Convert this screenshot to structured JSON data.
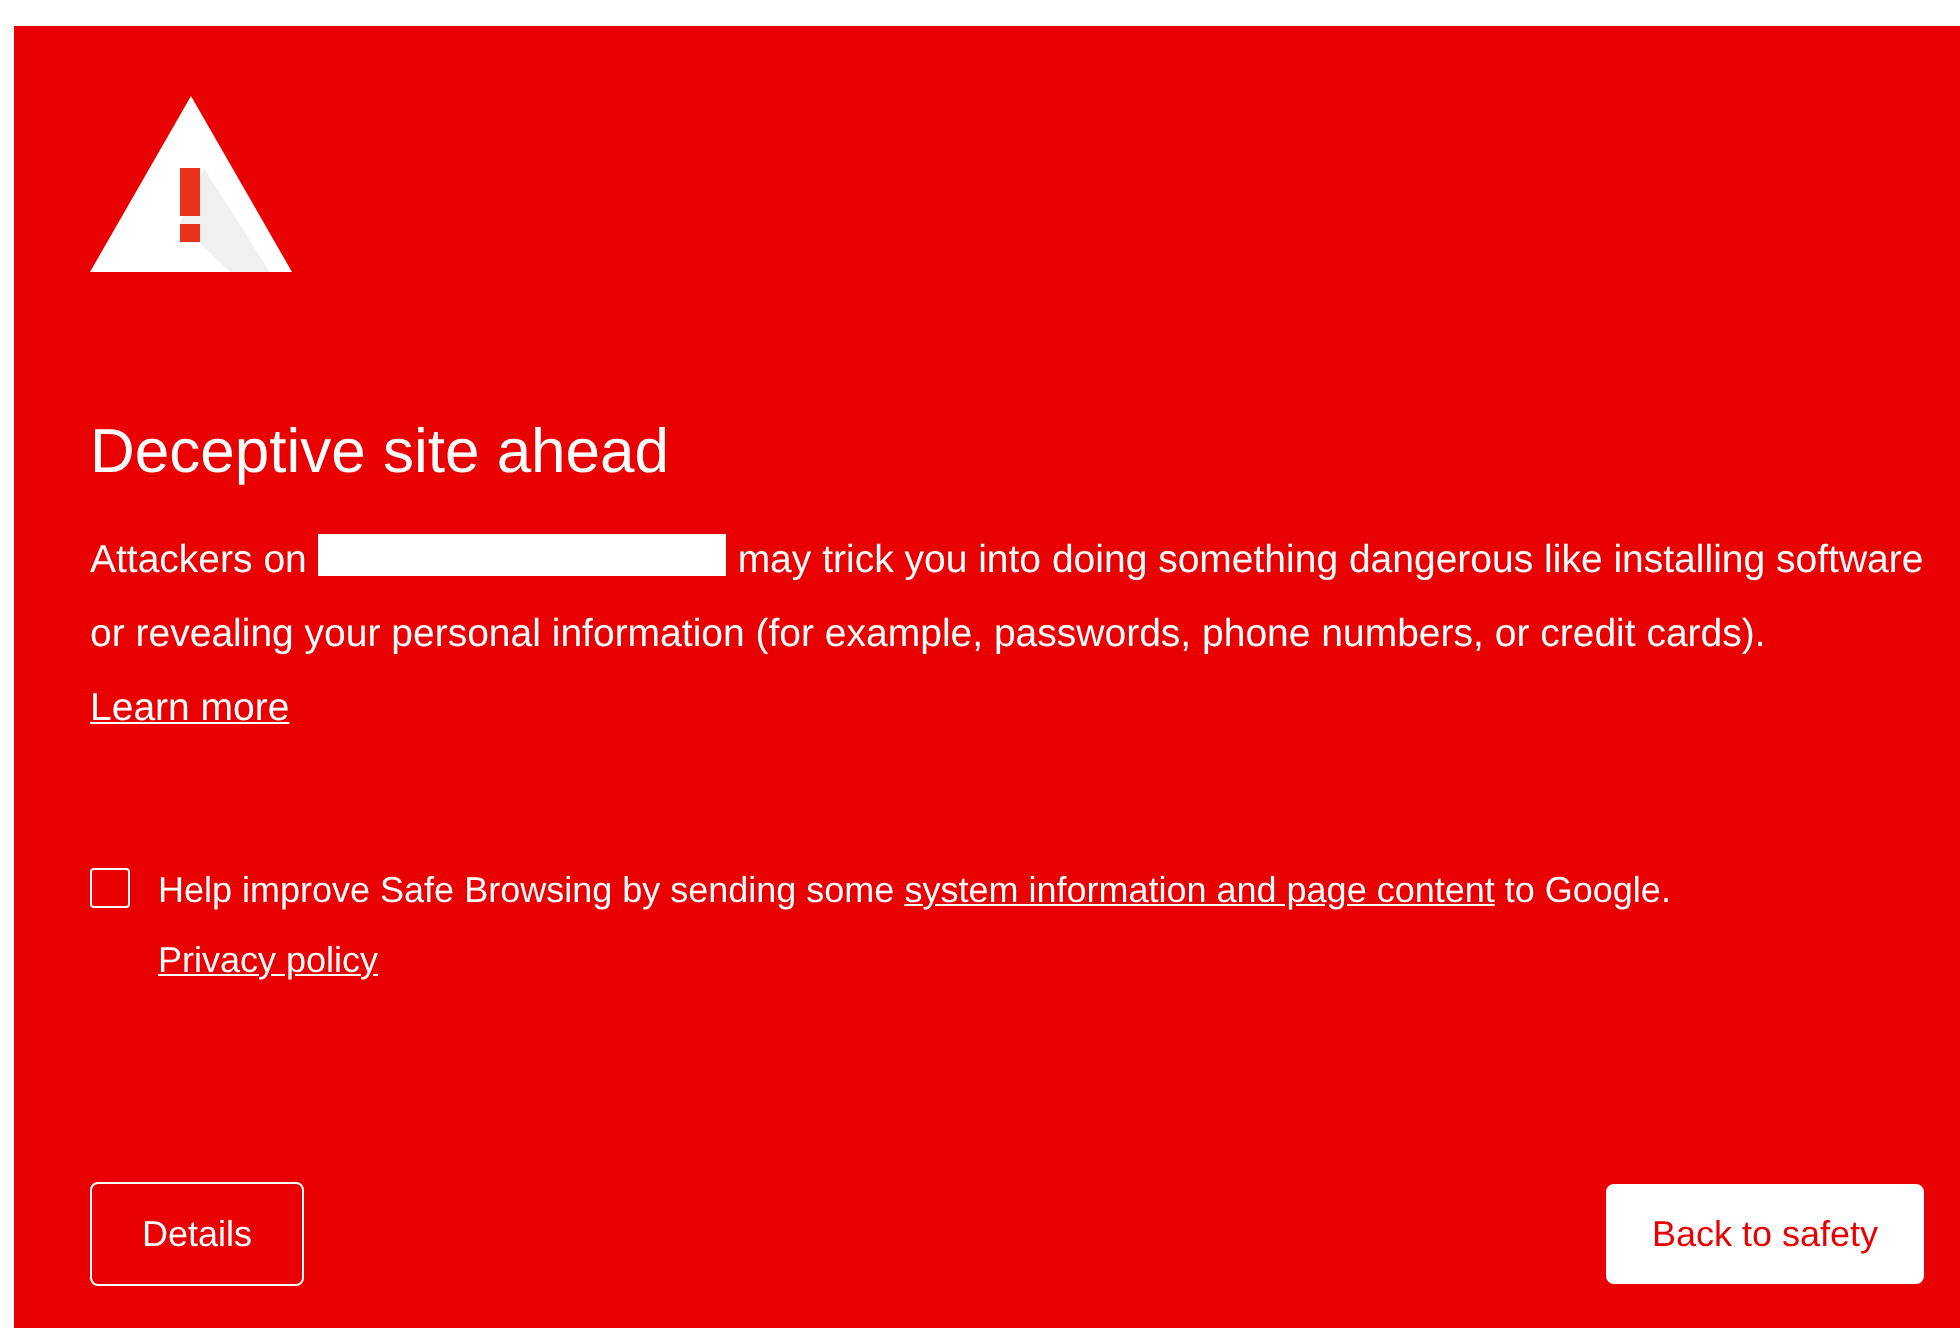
{
  "title": "Deceptive site ahead",
  "message": {
    "before": "Attackers on",
    "after": "may trick you into doing something dangerous like installing software or revealing your personal information (for example, passwords, phone numbers, or credit cards).",
    "link": "Learn more"
  },
  "report": {
    "checked": false,
    "before": "Help improve Safe Browsing by sending some",
    "link": "system information and page content",
    "after": "to Google."
  },
  "privacy_link": "Privacy policy",
  "buttons": [
    {
      "label": "Details",
      "kind": "secondary"
    },
    {
      "label": "Back to safety",
      "kind": "primary"
    }
  ]
}
